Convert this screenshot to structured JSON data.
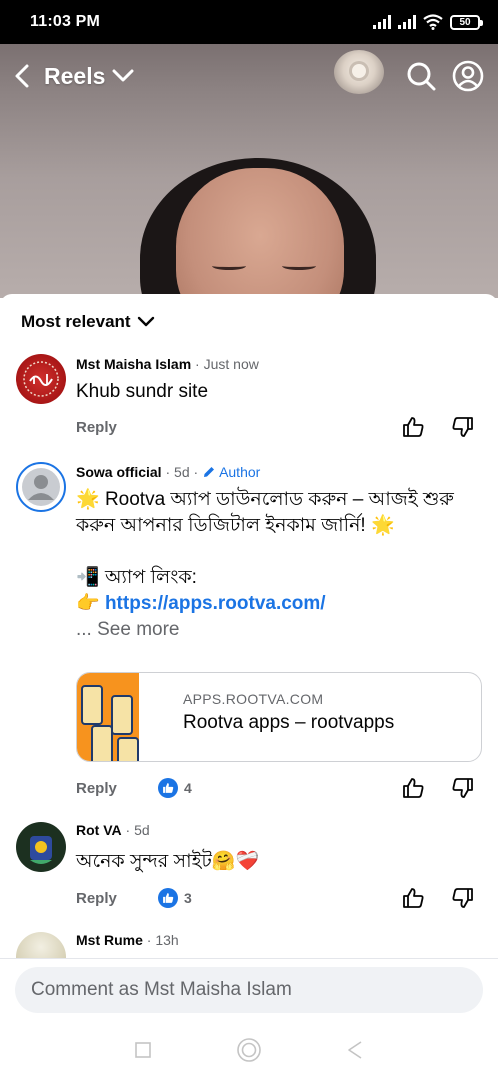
{
  "status_bar": {
    "time": "11:03 PM",
    "battery": "50"
  },
  "header": {
    "title": "Reels"
  },
  "sort": {
    "label": "Most relevant"
  },
  "comments": [
    {
      "name": "Mst Maisha Islam",
      "time": "Just now",
      "text": "Khub sundr site",
      "reply": "Reply"
    },
    {
      "name": "Sowa official",
      "time": "5d",
      "author_label": "Author",
      "line1": "Rootva অ্যাপ ডাউনলোড করুন – আজই শুরু",
      "line2": "করুন আপনার ডিজিটাল ইনকাম জার্নি!",
      "line3": "অ্যাপ লিংক:",
      "link": "https://apps.rootva.com/",
      "see_more": "... See more",
      "card_domain": "APPS.ROOTVA.COM",
      "card_title": "Rootva apps – rootvapps",
      "reply": "Reply",
      "likes": "4"
    },
    {
      "name": "Rot VA",
      "time": "5d",
      "text": "অনেক সুন্দর সাইট",
      "reply": "Reply",
      "likes": "3"
    },
    {
      "name": "Mst Rume",
      "time": "13h"
    }
  ],
  "composer": {
    "placeholder": "Comment as Mst Maisha Islam"
  },
  "colors": {
    "accent": "#1b74e4",
    "secondary_text": "#65676b",
    "composer_bg": "#f0f2f5"
  },
  "icons": [
    "back-chevron-icon",
    "dropdown-chevron-icon",
    "search-icon",
    "profile-icon",
    "thumbs-up-icon",
    "thumbs-down-icon",
    "pencil-icon",
    "recent-apps-icon",
    "home-icon",
    "back-icon"
  ]
}
